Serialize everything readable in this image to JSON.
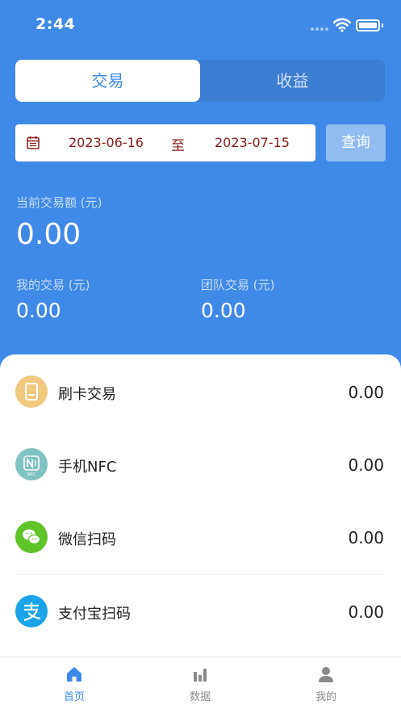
{
  "status_bar": {
    "time": "2:44"
  },
  "segment": {
    "active": "交易",
    "inactive": "收益"
  },
  "date_filter": {
    "start": "2023-06-16",
    "separator": "至",
    "end": "2023-07-15",
    "query_label": "查询"
  },
  "summary": {
    "current_label": "当前交易额 (元)",
    "current_value": "0.00",
    "my_label": "我的交易 (元)",
    "my_value": "0.00",
    "team_label": "团队交易 (元)",
    "team_value": "0.00"
  },
  "rows": [
    {
      "label": "刷卡交易",
      "value": "0.00",
      "icon": "card-terminal-icon",
      "color": "#f2c77e"
    },
    {
      "label": "手机NFC",
      "value": "0.00",
      "icon": "nfc-icon",
      "color": "#7fc4c2"
    },
    {
      "label": "微信扫码",
      "value": "0.00",
      "icon": "wechat-icon",
      "color": "#5ec42a"
    },
    {
      "label": "支付宝扫码",
      "value": "0.00",
      "icon": "alipay-icon",
      "color": "#1aa3e8"
    }
  ],
  "tabbar": [
    {
      "label": "首页",
      "icon": "home-icon",
      "active": true
    },
    {
      "label": "数据",
      "icon": "bar-chart-icon",
      "active": false
    },
    {
      "label": "我的",
      "icon": "user-icon",
      "active": false
    }
  ],
  "colors": {
    "primary": "#3f8ae6",
    "inactive_tab": "#8a8a8a",
    "date_text": "#8b1a1a"
  }
}
